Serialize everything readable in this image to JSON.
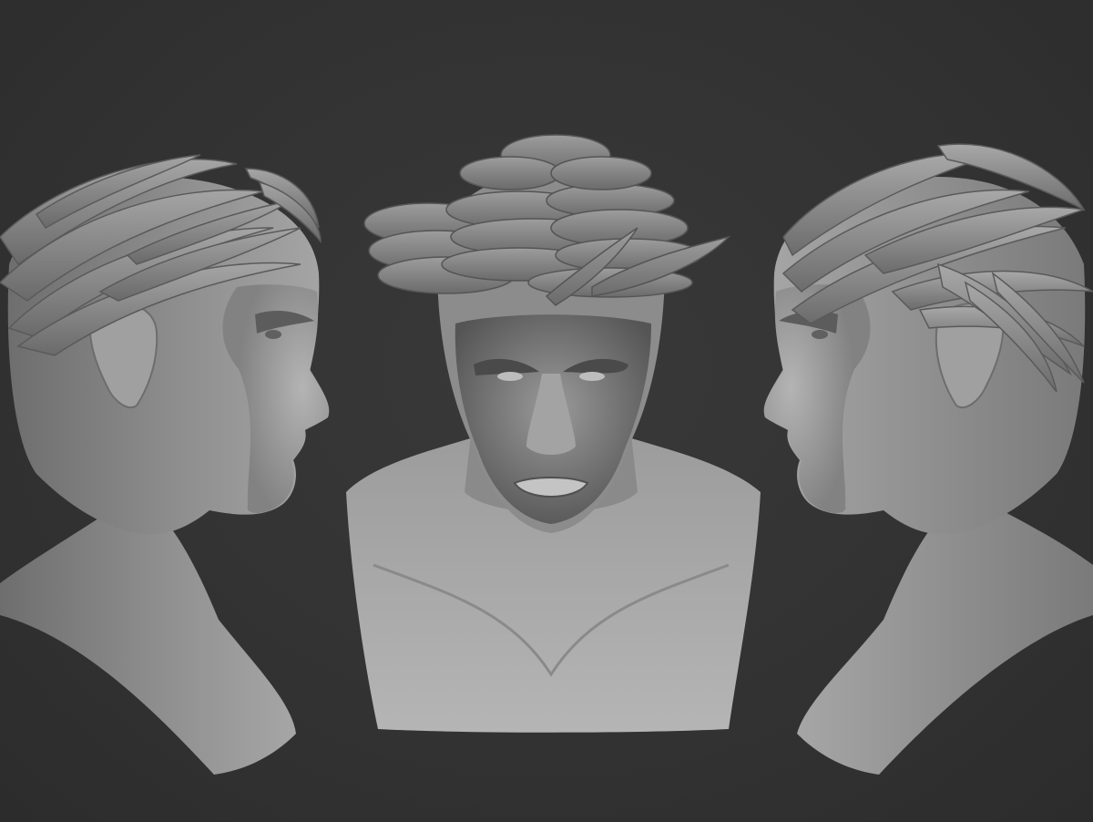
{
  "scene": {
    "background_color": "#333333",
    "views": [
      {
        "id": "left-profile",
        "facing": "right"
      },
      {
        "id": "front",
        "facing": "viewer"
      },
      {
        "id": "right-profile",
        "facing": "left"
      }
    ],
    "material_color": "#8c8c8c"
  }
}
